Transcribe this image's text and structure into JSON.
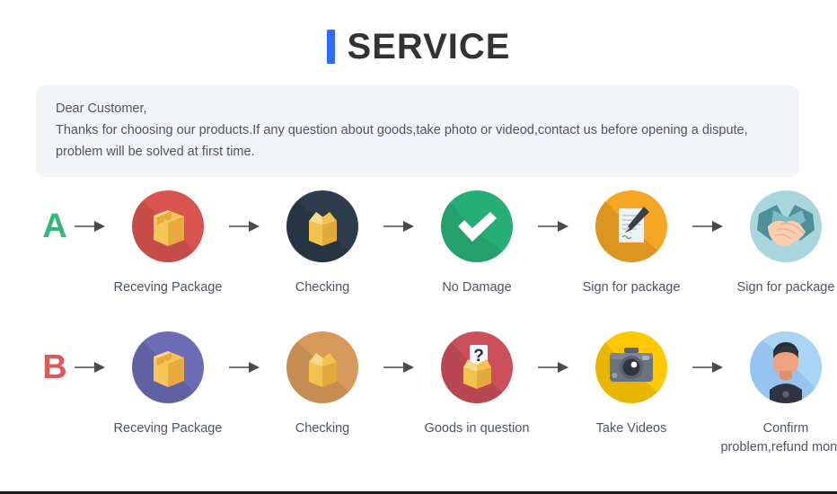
{
  "header": {
    "title": "SERVICE",
    "accent_color": "#2f6bff"
  },
  "notice": {
    "lines": [
      "Dear Customer,",
      "Thanks for choosing our products.If any question about goods,take photo or videod,contact us before opening a dispute,",
      "problem will be solved at first time."
    ],
    "background_color": "#f4f5f9",
    "text_color": "#4b5563"
  },
  "flows": [
    {
      "letter": "A",
      "letter_color": "#32b878",
      "steps": [
        {
          "label": "Receving Package",
          "icon": "closed-box-icon",
          "circle_color": "#d9544f"
        },
        {
          "label": "Checking",
          "icon": "open-box-icon",
          "circle_color": "#2e3d4e"
        },
        {
          "label": "No Damage",
          "icon": "check-mark-icon",
          "circle_color": "#27ae76"
        },
        {
          "label": "Sign for package",
          "icon": "document-pen-icon",
          "circle_color": "#f5a623"
        },
        {
          "label": "Sign for package",
          "icon": "handshake-icon",
          "circle_color": "#a9d6dd"
        }
      ]
    },
    {
      "letter": "B",
      "letter_color": "#dd5a5a",
      "steps": [
        {
          "label": "Receving Package",
          "icon": "closed-box-icon",
          "circle_color": "#6b6cb5"
        },
        {
          "label": "Checking",
          "icon": "open-box-icon",
          "circle_color": "#d79a5b"
        },
        {
          "label": "Goods in question",
          "icon": "question-box-icon",
          "circle_color": "#cc4f5c"
        },
        {
          "label": "Take Videos",
          "icon": "camera-icon",
          "circle_color": "#ffc800"
        },
        {
          "label": "Confirm problem,refund money",
          "icon": "person-avatar-icon",
          "circle_color": "#a9d4f5"
        }
      ]
    }
  ],
  "arrow": {
    "color": "#4a4a4a",
    "icon": "arrow-right-icon"
  }
}
